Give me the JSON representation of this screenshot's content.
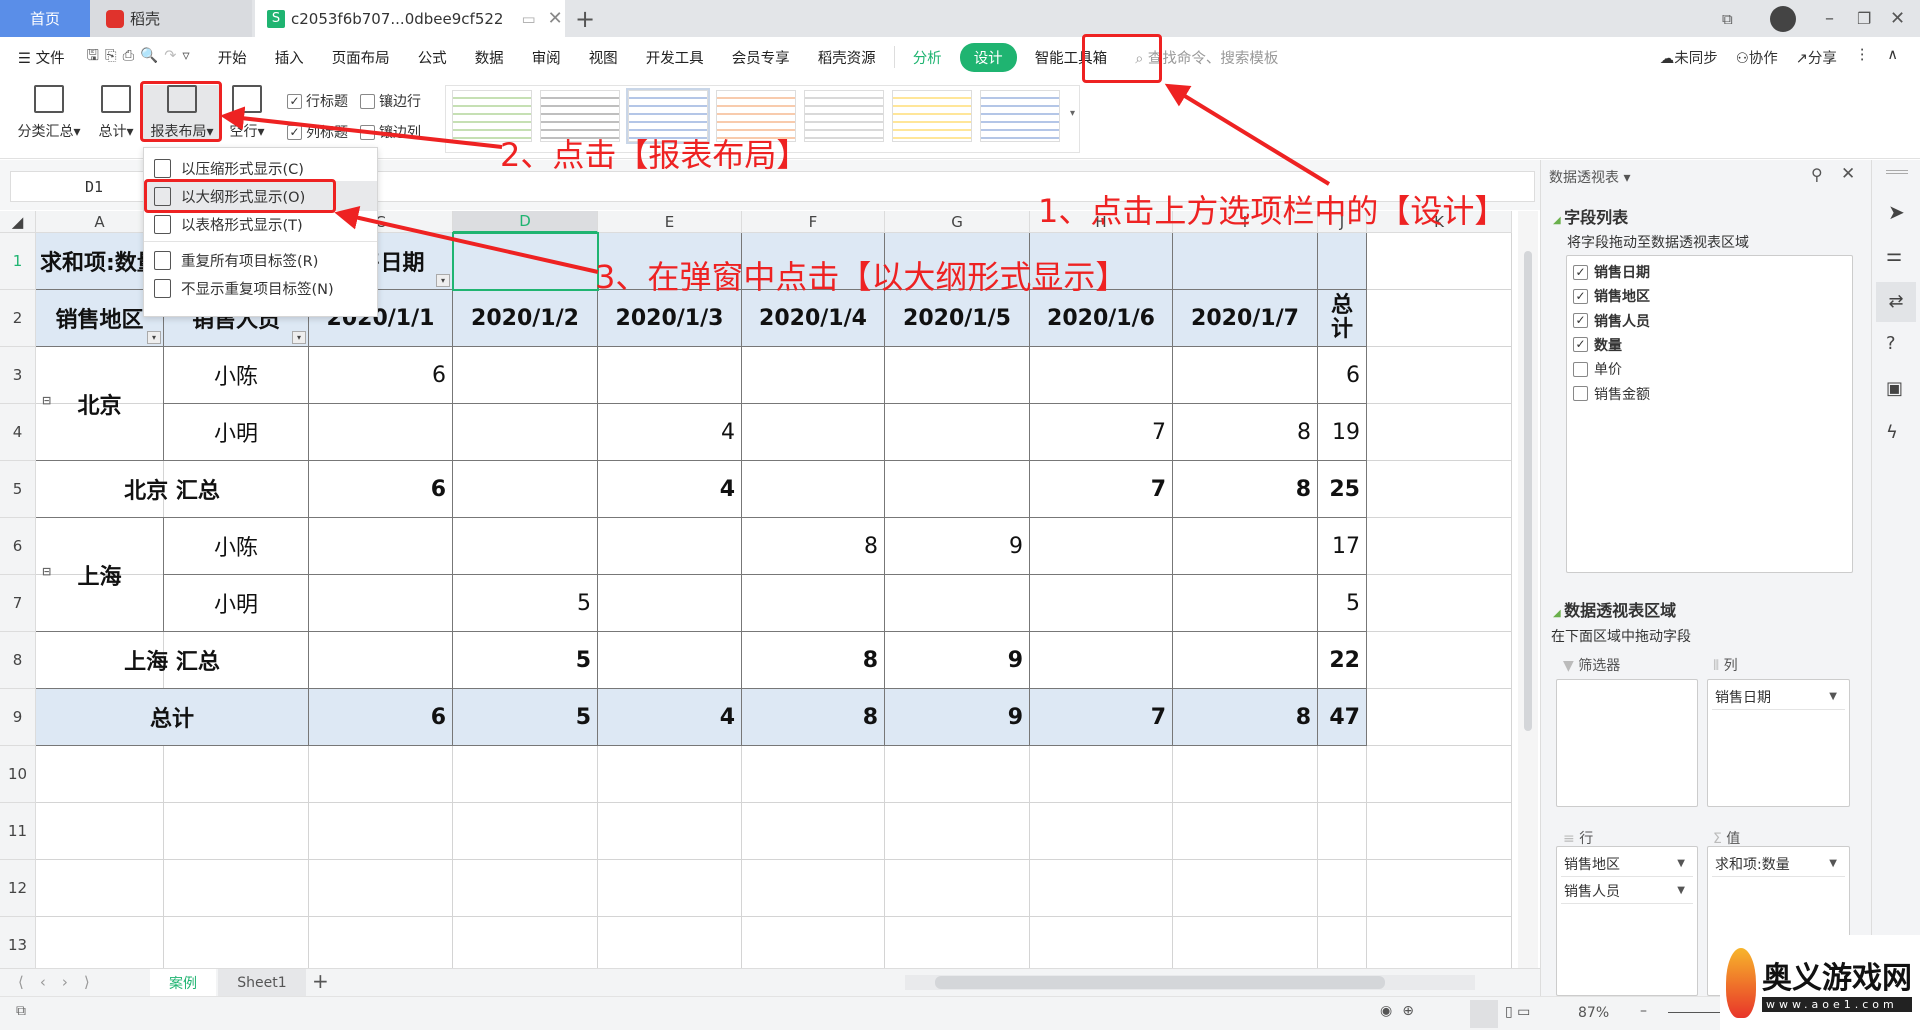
{
  "tabs": {
    "home": "首页",
    "docer": "稻壳",
    "file": "c2053f6b707...0dbee9cf522",
    "new_tab": "+"
  },
  "menu": {
    "file": "文件",
    "items": [
      "开始",
      "插入",
      "页面布局",
      "公式",
      "数据",
      "审阅",
      "视图",
      "开发工具",
      "会员专享",
      "稻壳资源"
    ],
    "context_items": [
      "分析",
      "设计",
      "智能工具箱"
    ],
    "active": "设计",
    "search_placeholder": "查找命令、搜索模板",
    "sync": "未同步",
    "collab": "协作",
    "share": "分享"
  },
  "ribbon": {
    "subtotal": "分类汇总",
    "grand_total": "总计",
    "report_layout": "报表布局",
    "blank_rows": "空行",
    "checkboxes": [
      {
        "label": "行标题",
        "checked": true
      },
      {
        "label": "镶边行",
        "checked": false
      },
      {
        "label": "列标题",
        "checked": true
      },
      {
        "label": "镶边列",
        "checked": false
      }
    ],
    "style_colors": [
      "#c6e0b4",
      "#bfbfbf",
      "#b4c6e7",
      "#f8cbad",
      "#d9d9d9",
      "#ffe699",
      "#b4c6e7"
    ]
  },
  "namebox": "D1",
  "columns": [
    "A",
    "B",
    "C",
    "D",
    "E",
    "F",
    "G",
    "H",
    "I",
    "J",
    "K"
  ],
  "selected_column": "D",
  "row_numbers": [
    "1",
    "2",
    "3",
    "4",
    "5",
    "6",
    "7",
    "8",
    "9",
    "10",
    "11",
    "12",
    "13"
  ],
  "pivot": {
    "corner_label": "求和项:数量",
    "column_field": "销售日期",
    "row_fields": [
      "销售地区",
      "销售人员"
    ],
    "dates": [
      "2020/1/1",
      "2020/1/2",
      "2020/1/3",
      "2020/1/4",
      "2020/1/5",
      "2020/1/6",
      "2020/1/7"
    ],
    "total_label": "总计",
    "groups": [
      {
        "region": "北京",
        "persons": [
          {
            "name": "小陈",
            "values": [
              "6",
              "",
              "",
              "",
              "",
              "",
              "",
              "6"
            ]
          },
          {
            "name": "小明",
            "values": [
              "",
              "",
              "4",
              "",
              "",
              "7",
              "8",
              "19"
            ]
          }
        ],
        "subtotal_label": "北京 汇总",
        "subtotal": [
          "6",
          "",
          "4",
          "",
          "",
          "7",
          "8",
          "25"
        ]
      },
      {
        "region": "上海",
        "persons": [
          {
            "name": "小陈",
            "values": [
              "",
              "",
              "",
              "8",
              "9",
              "",
              "",
              "17"
            ]
          },
          {
            "name": "小明",
            "values": [
              "",
              "5",
              "",
              "",
              "",
              "",
              "",
              "5"
            ]
          }
        ],
        "subtotal_label": "上海 汇总",
        "subtotal": [
          "",
          "5",
          "",
          "8",
          "9",
          "",
          "",
          "22"
        ]
      }
    ],
    "grand_total_label": "总计",
    "grand_total": [
      "6",
      "5",
      "4",
      "8",
      "9",
      "7",
      "8",
      "47"
    ],
    "header_fill": "#dde8f4"
  },
  "popup": {
    "items": [
      "以压缩形式显示(C)",
      "以大纲形式显示(O)",
      "以表格形式显示(T)",
      "重复所有项目标签(R)",
      "不显示重复项目标签(N)"
    ],
    "highlighted": "以大纲形式显示(O)"
  },
  "sheets": {
    "tabs": [
      "案例",
      "Sheet1"
    ],
    "active": "案例",
    "add": "+"
  },
  "status": {
    "zoom": "87%"
  },
  "panel": {
    "title": "数据透视表",
    "field_list_title": "字段列表",
    "field_list_hint": "将字段拖动至数据透视表区域",
    "fields": [
      {
        "label": "销售日期",
        "checked": true
      },
      {
        "label": "销售地区",
        "checked": true
      },
      {
        "label": "销售人员",
        "checked": true
      },
      {
        "label": "数量",
        "checked": true
      },
      {
        "label": "单价",
        "checked": false
      },
      {
        "label": "销售金额",
        "checked": false
      }
    ],
    "areas_title": "数据透视表区域",
    "areas_hint": "在下面区域中拖动字段",
    "filter_label": "筛选器",
    "columns_label": "列",
    "rows_label": "行",
    "values_label": "值",
    "columns_items": [
      "销售日期"
    ],
    "rows_items": [
      "销售地区",
      "销售人员"
    ],
    "values_items": [
      "求和项:数量"
    ]
  },
  "annotations": {
    "step1": "1、点击上方选项栏中的【设计】",
    "step2": "2、点击【报表布局】",
    "step3": "3、在弹窗中点击【以大纲形式显示】",
    "color": "#ee2222"
  },
  "watermark": {
    "logo_name": "奥义游戏网",
    "logo_url": "www.aoe1.com"
  }
}
